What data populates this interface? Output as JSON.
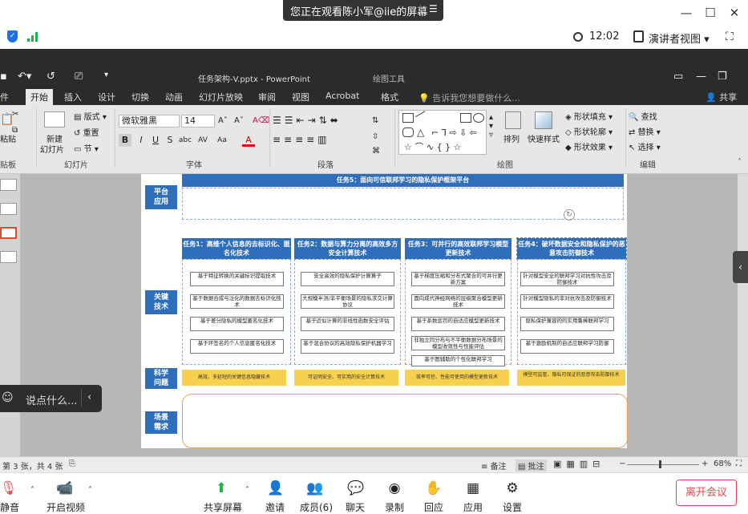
{
  "meeting": {
    "viewing_banner": "您正在观看陈小军@iie的屏幕",
    "clock": "12:02",
    "presenter_view": "演讲者视图",
    "toolbar": [
      "静音",
      "开启视频",
      "共享屏幕",
      "邀请",
      "成员(6)",
      "聊天",
      "录制",
      "回应",
      "应用",
      "设置"
    ],
    "leave": "离开会议",
    "chat_placeholder": "说点什么..."
  },
  "ppt": {
    "title": "任务架构-V.pptx - PowerPoint",
    "context_tools": "绘图工具",
    "tabs": [
      "件",
      "开始",
      "插入",
      "设计",
      "切换",
      "动画",
      "幻灯片放映",
      "审阅",
      "视图",
      "Acrobat",
      "格式"
    ],
    "tell_me": "告诉我您想要做什么...",
    "share": "共享",
    "groups": [
      "贴板",
      "幻灯片",
      "字体",
      "段落",
      "绘图",
      "编辑"
    ],
    "ribbon": {
      "layout": "版式",
      "reset": "重置",
      "section": "节",
      "new_slide_1": "新建",
      "new_slide_2": "幻灯片",
      "font_name": "微软雅黑",
      "font_size": "14",
      "arrange": "排列",
      "quick_styles": "快速样式",
      "shape_fill": "形状填充",
      "shape_outline": "形状轮廓",
      "shape_effects": "形状效果",
      "find": "查找",
      "replace": "替换",
      "select": "选择",
      "paste": "粘贴"
    },
    "status": {
      "slide_info": "第 3 张，共 4 张",
      "notes": "备注",
      "comments": "批注",
      "zoom": "68%"
    }
  },
  "slide": {
    "task5": "任务5：面向可信联邦学习的隐私保护框架平台",
    "labels": {
      "platform": [
        "平台",
        "应用"
      ],
      "tech": [
        "关键",
        "技术"
      ],
      "science": [
        "科学",
        "问题"
      ],
      "scene": [
        "场景",
        "需求"
      ]
    },
    "tasks": [
      {
        "head": "任务1：高维个人信息的去标识化、匿名化技术",
        "items": [
          "基于特征转换的关键标识提取技术",
          "基于数据合成与泛化的数据去标识化技术",
          "基于差分隐私的模型匿名化技术",
          "基于环签名的个人信息匿名化技术"
        ],
        "science": "高效、多延短的关键信息隐藏技术"
      },
      {
        "head": "任务2：数据与算力分离的高效多方安全计算技术",
        "items": [
          "安全高效的隐私保护计算算子",
          "大规模半测/非平衡场景的隐私求交计算协议",
          "基于近似计算的非线性函数安全评估",
          "基于混合协议的高效隐私保护机器学习"
        ],
        "science": "可证明安全、可实用的安全计算技术"
      },
      {
        "head": "任务3：可并行的高效联邦学习模型更新技术",
        "items": [
          "基于梯度压缩和分布式聚合的可并行更新方案",
          "面向成代神经网络的层级聚合模型更新技术",
          "基于系数惩罚的自适应模型更新技术",
          "非独立同分布与不平衡数据分布场景的模型收敛性与性能评估",
          "基于图辅助的个性化联邦学习"
        ],
        "science": "效率可控、性能可使用的模型更新技术"
      },
      {
        "head": "任务4：破坏数据安全和隐私保护的恶意攻击防御技术",
        "items": [
          "针对模型安全的联邦学习对抗性攻击及防御技术",
          "针对模型隐私的非对抗攻击及防御技术",
          "隐私保护兼容的的实用鲁棒联邦学习",
          "基于激励机制的自适应联邦学习防御"
        ],
        "science": "模型可监管、隐私可保证的恶意攻击防御技术"
      }
    ]
  }
}
